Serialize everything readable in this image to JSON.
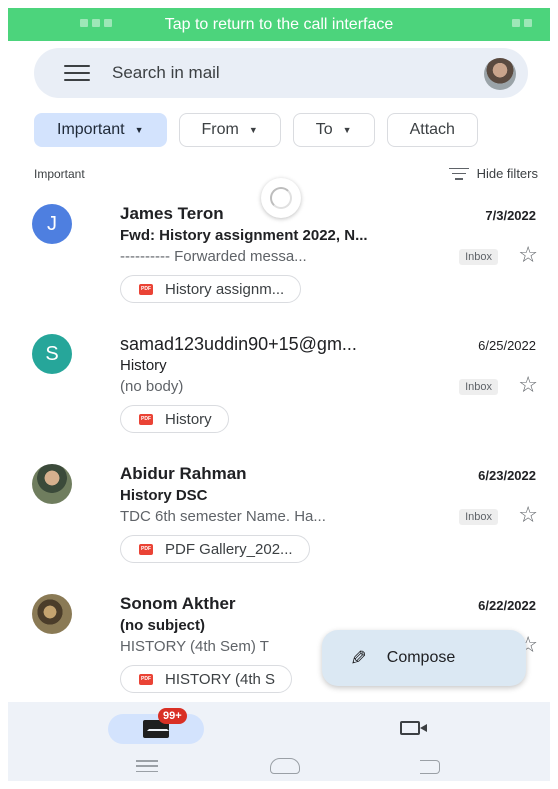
{
  "status_banner": {
    "text": "Tap to return to the call interface"
  },
  "search": {
    "placeholder": "Search in mail"
  },
  "filters": {
    "chips": [
      {
        "label": "Important",
        "active": true
      },
      {
        "label": "From",
        "active": false
      },
      {
        "label": "To",
        "active": false
      },
      {
        "label": "Attach",
        "active": false
      }
    ],
    "section_label": "Important",
    "hide_filters": "Hide filters"
  },
  "emails": [
    {
      "avatar_letter": "J",
      "avatar_color": "#4e7fe0",
      "sender": "James Teron",
      "date": "7/3/2022",
      "subject": "Fwd: History assignment 2022, N...",
      "snippet": "---------- Forwarded messa...",
      "label": "Inbox",
      "attachment": "History assignm..."
    },
    {
      "avatar_letter": "S",
      "avatar_color": "#26a69a",
      "sender": "samad123uddin90+15@gm...",
      "date": "6/25/2022",
      "subject": "History",
      "snippet": "(no body)",
      "label": "Inbox",
      "attachment": "History"
    },
    {
      "avatar_letter": "",
      "avatar_color": "",
      "sender": "Abidur Rahman",
      "date": "6/23/2022",
      "subject": "History DSC",
      "snippet": "TDC 6th semester Name. Ha...",
      "label": "Inbox",
      "attachment": "PDF Gallery_202..."
    },
    {
      "avatar_letter": "",
      "avatar_color": "",
      "sender": "Sonom Akther",
      "date": "6/22/2022",
      "subject": "(no subject)",
      "snippet": "HISTORY (4th Sem) T",
      "label": "",
      "attachment": "HISTORY (4th S"
    }
  ],
  "pdf_icon_text": "PDF",
  "compose": {
    "label": "Compose"
  },
  "bottom_nav": {
    "mail_badge": "99+"
  },
  "icons": {
    "menu": "menu-icon",
    "star": "☆",
    "pencil": "✎"
  },
  "colors": {
    "banner": "#4cd47c",
    "search_bg": "#e9eef6",
    "chip_active": "#d3e3fd",
    "badge_red": "#d93025"
  }
}
